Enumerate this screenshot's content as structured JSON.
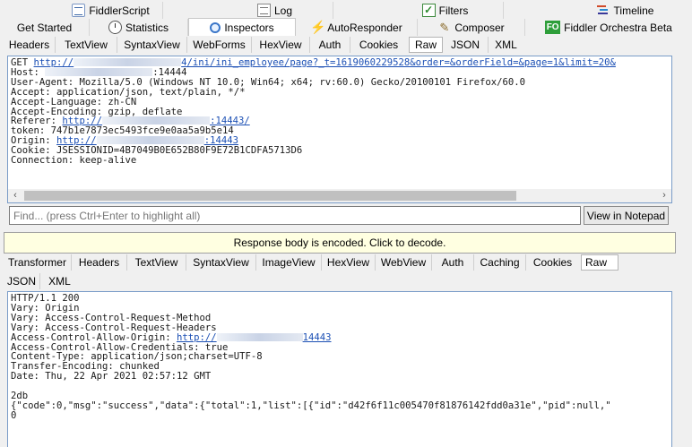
{
  "top_tabs": [
    {
      "label": "FiddlerScript",
      "icon": "script-icon"
    },
    {
      "label": "Log",
      "icon": "log-icon"
    },
    {
      "label": "Filters",
      "icon": "filters-check-icon"
    },
    {
      "label": "Timeline",
      "icon": "timeline-icon"
    }
  ],
  "main_tabs": [
    {
      "label": "Get Started"
    },
    {
      "label": "Statistics",
      "icon": "stopwatch-icon"
    },
    {
      "label": "Inspectors",
      "icon": "inspector-icon",
      "active": true
    },
    {
      "label": "AutoResponder",
      "icon": "lightning-icon"
    },
    {
      "label": "Composer",
      "icon": "pencil-icon"
    },
    {
      "label": "Fiddler Orchestra Beta",
      "icon": "fo-icon",
      "icon_text": "FO"
    }
  ],
  "request_tabs": [
    "Headers",
    "TextView",
    "SyntaxView",
    "WebForms",
    "HexView",
    "Auth",
    "Cookies",
    "Raw",
    "JSON",
    "XML"
  ],
  "request_active_tab": "Raw",
  "request": {
    "line1_prefix": "GET ",
    "line1_link_prefix": "http://",
    "line1_link_suffix": "4/ini/ini_employee/page?_t=1619060229528&order=&orderField=&page=1&limit=20&",
    "host_label": "Host: ",
    "host_port": ":14444",
    "user_agent": "User-Agent: Mozilla/5.0 (Windows NT 10.0; Win64; x64; rv:60.0) Gecko/20100101 Firefox/60.0",
    "accept": "Accept: application/json, text/plain, */*",
    "accept_language": "Accept-Language: zh-CN",
    "accept_encoding": "Accept-Encoding: gzip, deflate",
    "referer_label": "Referer: ",
    "referer_link_prefix": "http://",
    "referer_link_suffix": ":14443/",
    "token": "token: 747b1e7873ec5493fce9e0aa5a9b5e14",
    "origin_label": "Origin: ",
    "origin_link_prefix": "http://",
    "origin_link_suffix": ":14443",
    "cookie": "Cookie: JSESSIONID=4B7049B0E652B80F9E72B1CDFA5713D6",
    "connection": "Connection: keep-alive"
  },
  "find": {
    "placeholder": "Find... (press Ctrl+Enter to highlight all)",
    "button_label": "View in Notepad"
  },
  "response_banner": "Response body is encoded. Click to decode.",
  "response_tabs_row1": [
    "Transformer",
    "Headers",
    "TextView",
    "SyntaxView",
    "ImageView",
    "HexView",
    "WebView",
    "Auth",
    "Caching",
    "Cookies",
    "Raw"
  ],
  "response_tabs_row2": [
    "JSON",
    "XML"
  ],
  "response_active_tab": "Raw",
  "response": {
    "status": "HTTP/1.1 200",
    "vary1": "Vary: Origin",
    "vary2": "Vary: Access-Control-Request-Method",
    "vary3": "Vary: Access-Control-Request-Headers",
    "acao_label": "Access-Control-Allow-Origin: ",
    "acao_link_prefix": "http://",
    "acao_link_suffix": "14443",
    "acac": "Access-Control-Allow-Credentials: true",
    "content_type": "Content-Type: application/json;charset=UTF-8",
    "transfer_encoding": "Transfer-Encoding: chunked",
    "date": "Date: Thu, 22 Apr 2021 02:57:12 GMT",
    "chunk_size": "2db",
    "body": "{\"code\":0,\"msg\":\"success\",\"data\":{\"total\":1,\"list\":[{\"id\":\"d42f6f11c005470f81876142fdd0a31e\",\"pid\":null,\"",
    "chunk_end": "0"
  },
  "colors": {
    "link": "#1b4fb4",
    "pane_border": "#7a9cc8",
    "banner_bg": "#ffffe1",
    "fo_badge": "#2e9e3a"
  }
}
